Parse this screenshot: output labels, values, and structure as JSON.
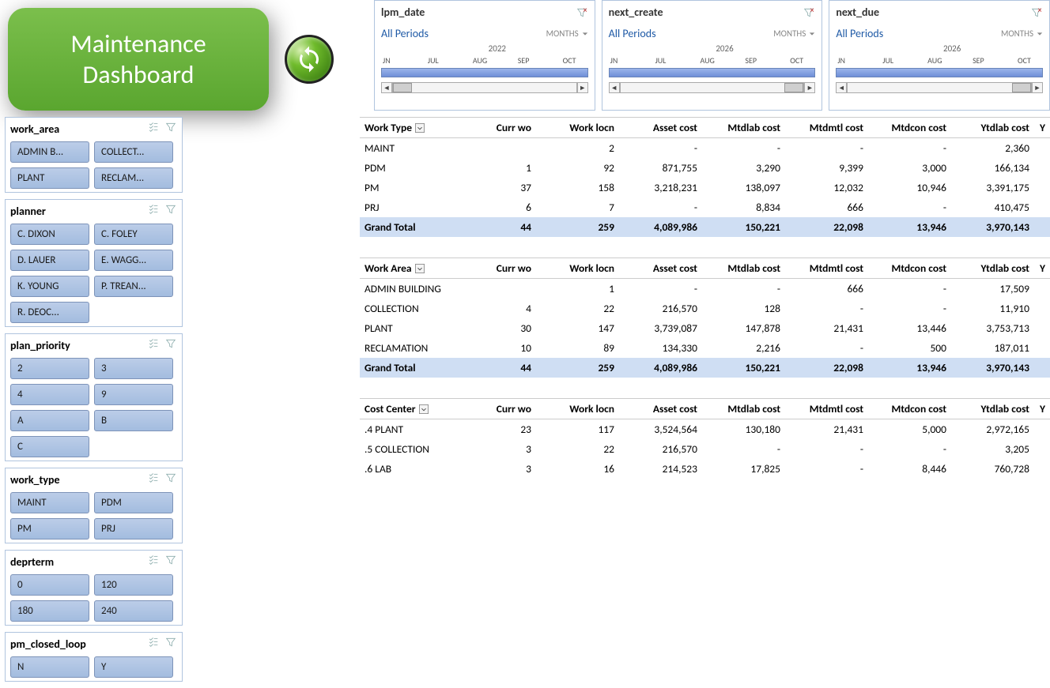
{
  "title": {
    "line1": "Maintenance",
    "line2": "Dashboard"
  },
  "timelines": [
    {
      "name": "lpm_date",
      "periods_label": "All Periods",
      "months_label": "MONTHS",
      "year": "2022",
      "labels": [
        "JN",
        "JUL",
        "AUG",
        "SEP",
        "OCT"
      ],
      "thumb": "left"
    },
    {
      "name": "next_create",
      "periods_label": "All Periods",
      "months_label": "MONTHS",
      "year": "2026",
      "labels": [
        "JN",
        "JUL",
        "AUG",
        "SEP",
        "OCT"
      ],
      "thumb": "right"
    },
    {
      "name": "next_due",
      "periods_label": "All Periods",
      "months_label": "MONTHS",
      "year": "2026",
      "labels": [
        "JN",
        "JUL",
        "AUG",
        "SEP",
        "OCT"
      ],
      "thumb": "right"
    }
  ],
  "slicers": [
    {
      "name": "work_area",
      "items": [
        "ADMIN B...",
        "COLLECT...",
        "PLANT",
        "RECLAM..."
      ]
    },
    {
      "name": "planner",
      "items": [
        "C. DIXON",
        "C. FOLEY",
        "D. LAUER",
        "E. WAGG...",
        "K. YOUNG",
        "P. TREAN...",
        "R. DEOC..."
      ]
    },
    {
      "name": "plan_priority",
      "items": [
        "2",
        "3",
        "4",
        "9",
        "A",
        "B",
        "C"
      ]
    },
    {
      "name": "work_type",
      "items": [
        "MAINT",
        "PDM",
        "PM",
        "PRJ"
      ]
    },
    {
      "name": "deprterm",
      "items": [
        "0",
        "120",
        "180",
        "240"
      ]
    },
    {
      "name": "pm_closed_loop",
      "items": [
        "N",
        "Y"
      ]
    }
  ],
  "pivots": [
    {
      "header_col": "Work Type",
      "columns": [
        "Curr wo",
        "Work locn",
        "Asset cost",
        "Mtdlab cost",
        "Mtdmtl cost",
        "Mtdcon cost",
        "Ytdlab cost",
        "Y"
      ],
      "rows": [
        {
          "label": "MAINT",
          "cells": [
            "",
            "2",
            "-",
            "-",
            "-",
            "-",
            "2,360",
            ""
          ]
        },
        {
          "label": "PDM",
          "cells": [
            "1",
            "92",
            "871,755",
            "3,290",
            "9,399",
            "3,000",
            "166,134",
            ""
          ]
        },
        {
          "label": "PM",
          "cells": [
            "37",
            "158",
            "3,218,231",
            "138,097",
            "12,032",
            "10,946",
            "3,391,175",
            ""
          ]
        },
        {
          "label": "PRJ",
          "cells": [
            "6",
            "7",
            "-",
            "8,834",
            "666",
            "-",
            "410,475",
            ""
          ]
        }
      ],
      "grand": {
        "label": "Grand Total",
        "cells": [
          "44",
          "259",
          "4,089,986",
          "150,221",
          "22,098",
          "13,946",
          "3,970,143",
          ""
        ]
      }
    },
    {
      "header_col": "Work Area",
      "columns": [
        "Curr wo",
        "Work locn",
        "Asset cost",
        "Mtdlab cost",
        "Mtdmtl cost",
        "Mtdcon cost",
        "Ytdlab cost",
        "Y"
      ],
      "rows": [
        {
          "label": "ADMIN BUILDING",
          "cells": [
            "",
            "1",
            "-",
            "-",
            "666",
            "-",
            "17,509",
            ""
          ]
        },
        {
          "label": "COLLECTION",
          "cells": [
            "4",
            "22",
            "216,570",
            "128",
            "-",
            "-",
            "11,910",
            ""
          ]
        },
        {
          "label": "PLANT",
          "cells": [
            "30",
            "147",
            "3,739,087",
            "147,878",
            "21,431",
            "13,446",
            "3,753,713",
            ""
          ]
        },
        {
          "label": "RECLAMATION",
          "cells": [
            "10",
            "89",
            "134,330",
            "2,216",
            "-",
            "500",
            "187,011",
            ""
          ]
        }
      ],
      "grand": {
        "label": "Grand Total",
        "cells": [
          "44",
          "259",
          "4,089,986",
          "150,221",
          "22,098",
          "13,946",
          "3,970,143",
          ""
        ]
      }
    },
    {
      "header_col": "Cost Center",
      "columns": [
        "Curr wo",
        "Work locn",
        "Asset cost",
        "Mtdlab cost",
        "Mtdmtl cost",
        "Mtdcon cost",
        "Ytdlab cost",
        "Y"
      ],
      "rows": [
        {
          "label": ".4 PLANT",
          "cells": [
            "23",
            "117",
            "3,524,564",
            "130,180",
            "21,431",
            "5,000",
            "2,972,165",
            ""
          ]
        },
        {
          "label": ".5 COLLECTION",
          "cells": [
            "3",
            "22",
            "216,570",
            "-",
            "-",
            "-",
            "3,205",
            ""
          ]
        },
        {
          "label": ".6 LAB",
          "cells": [
            "3",
            "16",
            "214,523",
            "17,825",
            "-",
            "8,446",
            "760,728",
            ""
          ]
        }
      ],
      "grand": null
    }
  ]
}
